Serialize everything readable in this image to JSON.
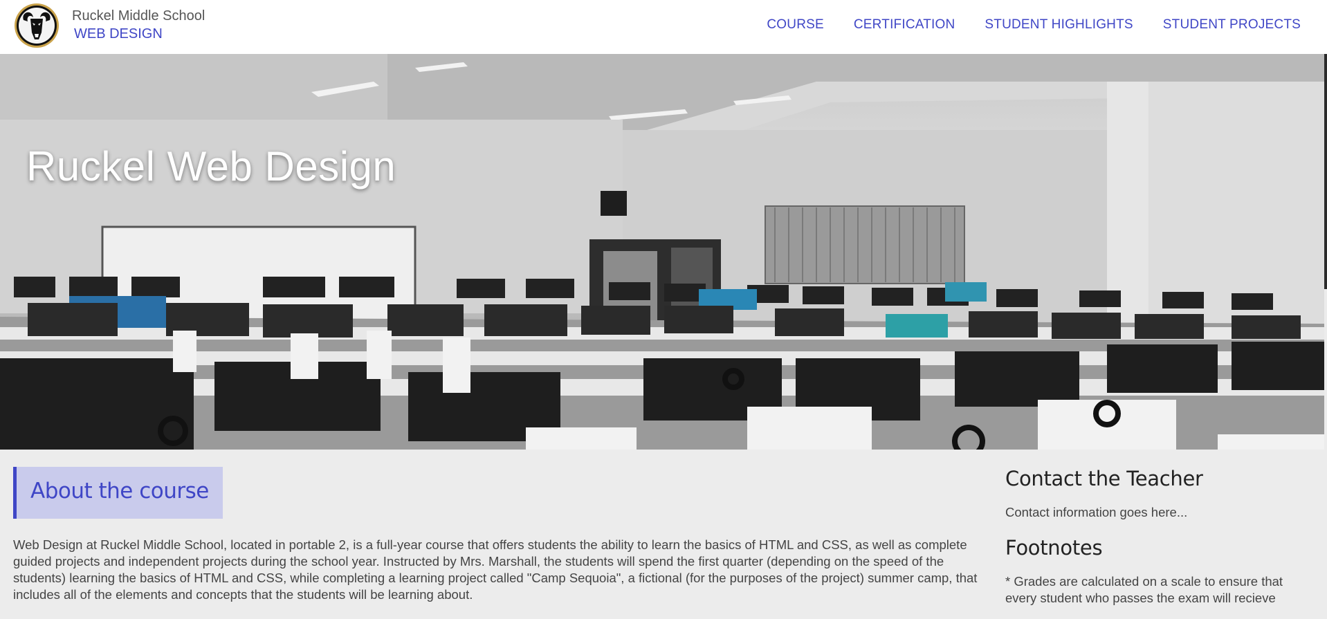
{
  "header": {
    "school_name": "Ruckel Middle School",
    "course_name": "WEB DESIGN",
    "nav": [
      {
        "label": "COURSE"
      },
      {
        "label": "CERTIFICATION"
      },
      {
        "label": "STUDENT HIGHLIGHTS"
      },
      {
        "label": "STUDENT PROJECTS"
      }
    ]
  },
  "hero": {
    "title": "Ruckel Web Design",
    "image": "grayscale-computer-lab-photo"
  },
  "main": {
    "about_heading": "About the course",
    "about_text": "Web Design at Ruckel Middle School, located in portable 2, is a full-year course that offers students the ability to learn the basics of HTML and CSS, as well as complete guided projects and independent projects during the school year. Instructed by Mrs. Marshall, the students will spend the first quarter (depending on the speed of the students) learning the basics of HTML and CSS, while completing a learning project called \"Camp Sequoia\", a fictional (for the purposes of the project) summer camp, that includes all of the elements and concepts that the students will be learning about."
  },
  "aside": {
    "contact_heading": "Contact the Teacher",
    "contact_text": "Contact information goes here...",
    "footnotes_heading": "Footnotes",
    "footnote_text": "* Grades are calculated on a scale to ensure that every student who passes the exam will recieve"
  },
  "colors": {
    "accent": "#3f46c6",
    "heading_bg": "#c9cbec",
    "page_bg": "#ececec"
  }
}
